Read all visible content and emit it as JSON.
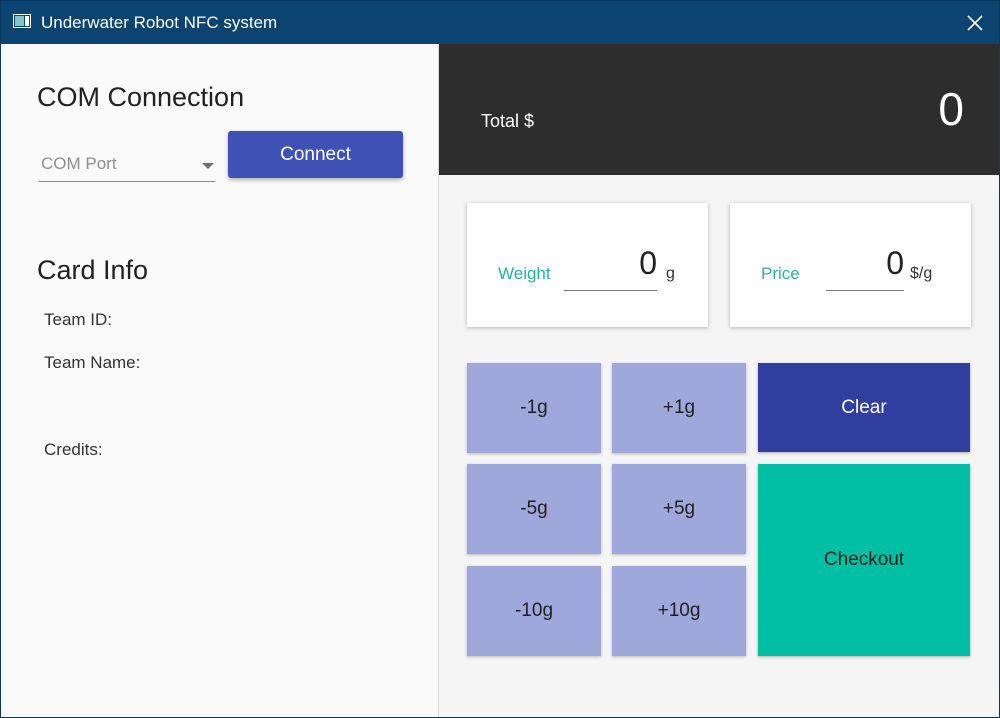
{
  "window": {
    "title": "Underwater Robot NFC system"
  },
  "icons": {
    "app": "app-window-icon",
    "close": "close-icon",
    "dropdown": "caret-down-icon"
  },
  "colors": {
    "titlebar": "#0b4371",
    "primary": "#3f51b5",
    "primary_dark": "#303f9f",
    "adjust_button": "#9fa8da",
    "accent_teal": "#00bfa5",
    "label_teal": "#26b3a0",
    "total_bar": "#2d2d2d"
  },
  "com_connection": {
    "heading": "COM Connection",
    "port_select": {
      "placeholder": "COM Port",
      "value": ""
    },
    "connect_label": "Connect"
  },
  "card_info": {
    "heading": "Card Info",
    "team_id_label": "Team ID:",
    "team_name_label": "Team Name:",
    "credits_label": "Credits:"
  },
  "total": {
    "label": "Total $",
    "value": "0"
  },
  "weight": {
    "label": "Weight",
    "value": "0",
    "unit": "g"
  },
  "price": {
    "label": "Price",
    "value": "0",
    "unit": "$/g"
  },
  "adjust_buttons": {
    "minus_1": "-1g",
    "plus_1": "+1g",
    "minus_5": "-5g",
    "plus_5": "+5g",
    "minus_10": "-10g",
    "plus_10": "+10g"
  },
  "actions": {
    "clear_label": "Clear",
    "checkout_label": "Checkout"
  }
}
